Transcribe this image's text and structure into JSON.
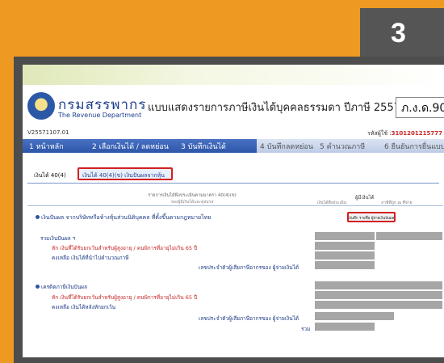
{
  "step_number": "3",
  "header": {
    "department_th": "กรมสรรพากร",
    "department_en": "The Revenue Department",
    "form_title": "แบบแสดงรายการภาษีเงินได้บุคคลธรรมดา ปีภาษี 2557",
    "form_code": "ภ.ง.ด.90/"
  },
  "ref_number": "V25571107.01",
  "tax_id_label": "รหัสผู้ใช้ :",
  "tax_id_value": "3101201215777",
  "nav": [
    {
      "num": "1",
      "label": "หน้าหลัก"
    },
    {
      "num": "2",
      "label": "เลือกเงินได้ / ลดหย่อน"
    },
    {
      "num": "3",
      "label": "บันทึกเงินได้"
    },
    {
      "num": "4",
      "label": "บันทึกลดหย่อน"
    },
    {
      "num": "5",
      "label": "คำนวณภาษี"
    },
    {
      "num": "6",
      "label": "ยืนยันการยื่นแบบ"
    }
  ],
  "tabs": {
    "tab1": "เงินได้ 40(4)",
    "tab2": "เงินได้ 40(4)(ข) เงินปันผลจากหุ้น"
  },
  "column_header": {
    "left_line1": "รายการเงินได้พึงประเมินตามมาตรา 40(4)(ข)",
    "left_line2": "ของผู้มีเงินได้และคู่สมรส",
    "right_title": "ผู้มีเงินได้",
    "right_sub1": "เงินได้พึงประเมิน",
    "right_sub2": "ภาษีที่ถูก ณ ที่จ่าย"
  },
  "section1": {
    "title": "เงินปันผล จากบริษัทหรือห้างหุ้นส่วนนิติบุคคล ที่ตั้งขึ้นตามกฎหมายไทย",
    "save_button": "บันทึก รายชื่อ ผู้จ่ายเงินปันผล",
    "total_label": "รวมเงินปันผล ฯ",
    "exempt_label": "หัก เงินที่ได้รับยกเว้นสำหรับผู้สูงอายุ / คนพิการที่อายุไม่เกิน 65 ปี",
    "remain_label": "คงเหลือ เงินได้ที่นำไปคำนวณภาษี",
    "payer_label": "เลขประจำตัวผู้เสียภาษีอากรของ ผู้จ่ายเงินได้"
  },
  "section2": {
    "title": "เครดิตภาษีเงินปันผล",
    "exempt_label": "หัก เงินที่ได้รับยกเว้นสำหรับผู้สูงอายุ / คนพิการที่อายุไม่เกิน 65 ปี",
    "remain_label": "คงเหลือ เงินได้หลังหักยกเว้น",
    "payer_label": "เลขประจำตัวผู้เสียภาษีอากรของ ผู้จ่ายเงินได้",
    "total_label": "รวม"
  },
  "colors": {
    "background": "#ee9a22",
    "highlight": "#d32020",
    "nav_active": "#2c55a8"
  }
}
